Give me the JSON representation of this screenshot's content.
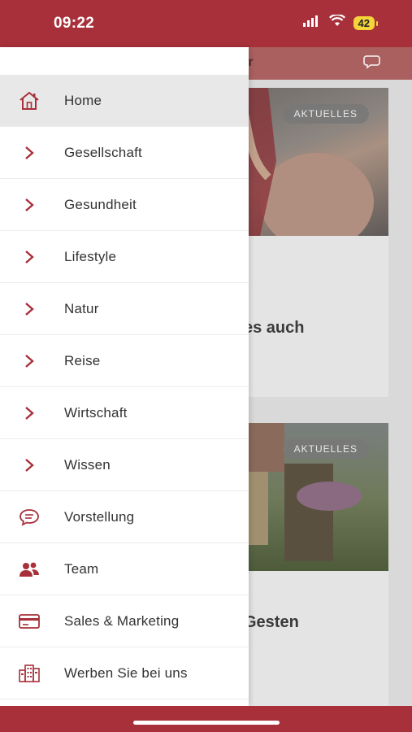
{
  "status_bar": {
    "time": "09:22",
    "battery": "42"
  },
  "background": {
    "app_bar_title": "ler",
    "cards": [
      {
        "badge": "AKTUELLES",
        "title_fragment": "es auch"
      },
      {
        "badge": "AKTUELLES",
        "title_fragment": "Gesten"
      }
    ]
  },
  "drawer": {
    "items": [
      {
        "label": "Home",
        "icon": "home-icon"
      },
      {
        "label": "Gesellschaft",
        "icon": "chevron-right-icon"
      },
      {
        "label": "Gesundheit",
        "icon": "chevron-right-icon"
      },
      {
        "label": "Lifestyle",
        "icon": "chevron-right-icon"
      },
      {
        "label": "Natur",
        "icon": "chevron-right-icon"
      },
      {
        "label": "Reise",
        "icon": "chevron-right-icon"
      },
      {
        "label": "Wirtschaft",
        "icon": "chevron-right-icon"
      },
      {
        "label": "Wissen",
        "icon": "chevron-right-icon"
      },
      {
        "label": "Vorstellung",
        "icon": "chat-bubble-icon"
      },
      {
        "label": "Team",
        "icon": "people-icon"
      },
      {
        "label": "Sales & Marketing",
        "icon": "card-icon"
      },
      {
        "label": "Werben Sie bei uns",
        "icon": "building-icon"
      }
    ]
  },
  "colors": {
    "brand": "#a8303a",
    "icon": "#a8303a",
    "active_row": "#e8e8e8"
  }
}
